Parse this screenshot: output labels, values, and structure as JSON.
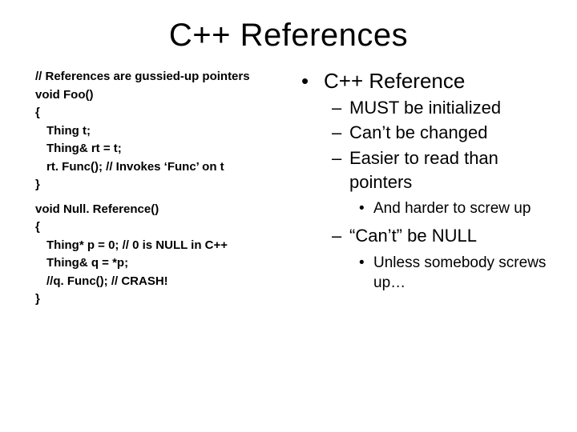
{
  "title": "C++ References",
  "code": {
    "l1": "// References are gussied-up pointers",
    "l2": "void Foo()",
    "l3": "{",
    "l4": "Thing t;",
    "l5": "Thing& rt = t;",
    "l6": "rt. Func(); // Invokes ‘Func’ on t",
    "l7": "}",
    "l8": "void Null. Reference()",
    "l9": "{",
    "l10": "Thing* p = 0; // 0 is NULL in C++",
    "l11": "Thing& q = *p;",
    "l12": "//q. Func(); // CRASH!",
    "l13": "}"
  },
  "bullets": {
    "h1": "C++ Reference",
    "s1": "MUST be initialized",
    "s2": "Can’t be changed",
    "s3": "Easier to read than pointers",
    "t1": "And harder to screw up",
    "s4": "“Can’t” be NULL",
    "t2": "Unless somebody screws up…"
  }
}
